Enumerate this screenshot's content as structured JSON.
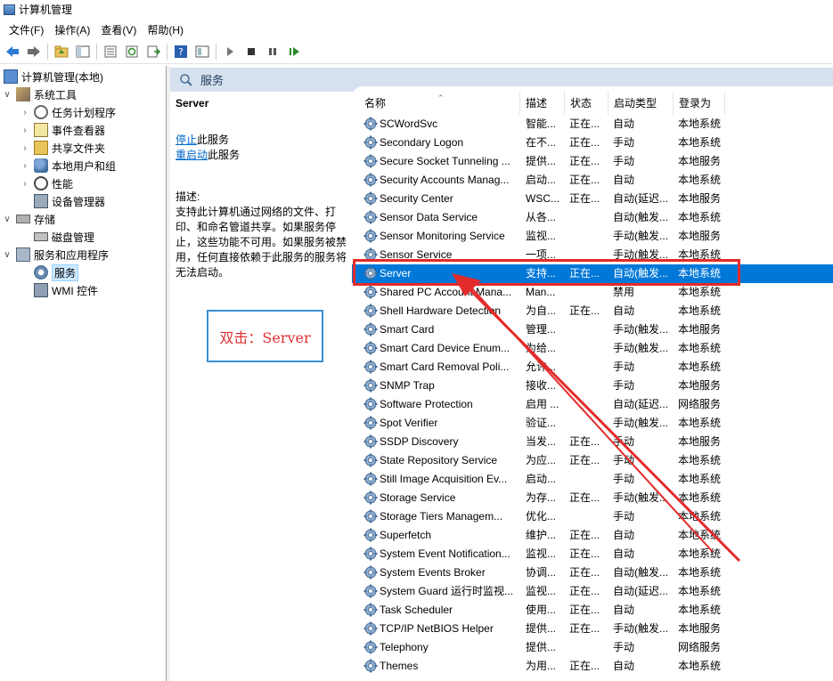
{
  "window": {
    "title": "计算机管理"
  },
  "menu": [
    "文件(F)",
    "操作(A)",
    "查看(V)",
    "帮助(H)"
  ],
  "toolbar": {
    "icons": [
      "back-arrow-icon",
      "forward-arrow-icon",
      "folder-up-icon",
      "show-hide-tree-icon",
      "properties-icon",
      "refresh-icon",
      "export-icon",
      "help-icon",
      "console-icon",
      "play-icon",
      "stop-icon",
      "pause-icon",
      "restart-icon"
    ]
  },
  "tree": {
    "root": "计算机管理(本地)",
    "system_tools": "系统工具",
    "task_scheduler": "任务计划程序",
    "event_viewer": "事件查看器",
    "shared_folders": "共享文件夹",
    "local_users": "本地用户和组",
    "performance": "性能",
    "device_manager": "设备管理器",
    "storage": "存储",
    "disk_management": "磁盘管理",
    "services_apps": "服务和应用程序",
    "services": "服务",
    "wmi": "WMI 控件"
  },
  "panel": {
    "title": "服务"
  },
  "description": {
    "service_name": "Server",
    "stop_link": "停止",
    "stop_suffix": "此服务",
    "restart_link": "重启动",
    "restart_suffix": "此服务",
    "desc_label": "描述:",
    "desc_text": "支持此计算机通过网络的文件、打印、和命名管道共享。如果服务停止，这些功能不可用。如果服务被禁用，任何直接依赖于此服务的服务将无法启动。"
  },
  "columns": {
    "name": "名称",
    "desc": "描述",
    "state": "状态",
    "startup": "启动类型",
    "logon": "登录为"
  },
  "services": [
    {
      "name": "SCWordSvc",
      "desc": "智能...",
      "state": "正在...",
      "startup": "自动",
      "logon": "本地系统"
    },
    {
      "name": "Secondary Logon",
      "desc": "在不...",
      "state": "正在...",
      "startup": "手动",
      "logon": "本地系统"
    },
    {
      "name": "Secure Socket Tunneling ...",
      "desc": "提供...",
      "state": "正在...",
      "startup": "手动",
      "logon": "本地服务"
    },
    {
      "name": "Security Accounts Manag...",
      "desc": "启动...",
      "state": "正在...",
      "startup": "自动",
      "logon": "本地系统"
    },
    {
      "name": "Security Center",
      "desc": "WSC...",
      "state": "正在...",
      "startup": "自动(延迟...",
      "logon": "本地服务"
    },
    {
      "name": "Sensor Data Service",
      "desc": "从各...",
      "state": "",
      "startup": "自动(触发...",
      "logon": "本地系统"
    },
    {
      "name": "Sensor Monitoring Service",
      "desc": "监视...",
      "state": "",
      "startup": "手动(触发...",
      "logon": "本地服务"
    },
    {
      "name": "Sensor Service",
      "desc": "一项...",
      "state": "",
      "startup": "手动(触发...",
      "logon": "本地系统"
    },
    {
      "name": "Server",
      "desc": "支持...",
      "state": "正在...",
      "startup": "自动(触发...",
      "logon": "本地系统"
    },
    {
      "name": "Shared PC Account Mana...",
      "desc": "Man...",
      "state": "",
      "startup": "禁用",
      "logon": "本地系统"
    },
    {
      "name": "Shell Hardware Detection",
      "desc": "为自...",
      "state": "正在...",
      "startup": "自动",
      "logon": "本地系统"
    },
    {
      "name": "Smart Card",
      "desc": "管理...",
      "state": "",
      "startup": "手动(触发...",
      "logon": "本地服务"
    },
    {
      "name": "Smart Card Device Enum...",
      "desc": "为给...",
      "state": "",
      "startup": "手动(触发...",
      "logon": "本地系统"
    },
    {
      "name": "Smart Card Removal Poli...",
      "desc": "允许...",
      "state": "",
      "startup": "手动",
      "logon": "本地系统"
    },
    {
      "name": "SNMP Trap",
      "desc": "接收...",
      "state": "",
      "startup": "手动",
      "logon": "本地服务"
    },
    {
      "name": "Software Protection",
      "desc": "启用 ...",
      "state": "",
      "startup": "自动(延迟...",
      "logon": "网络服务"
    },
    {
      "name": "Spot Verifier",
      "desc": "验证...",
      "state": "",
      "startup": "手动(触发...",
      "logon": "本地系统"
    },
    {
      "name": "SSDP Discovery",
      "desc": "当发...",
      "state": "正在...",
      "startup": "手动",
      "logon": "本地服务"
    },
    {
      "name": "State Repository Service",
      "desc": "为应...",
      "state": "正在...",
      "startup": "手动",
      "logon": "本地系统"
    },
    {
      "name": "Still Image Acquisition Ev...",
      "desc": "启动...",
      "state": "",
      "startup": "手动",
      "logon": "本地系统"
    },
    {
      "name": "Storage Service",
      "desc": "为存...",
      "state": "正在...",
      "startup": "手动(触发...",
      "logon": "本地系统"
    },
    {
      "name": "Storage Tiers Managem...",
      "desc": "优化...",
      "state": "",
      "startup": "手动",
      "logon": "本地系统"
    },
    {
      "name": "Superfetch",
      "desc": "维护...",
      "state": "正在...",
      "startup": "自动",
      "logon": "本地系统"
    },
    {
      "name": "System Event Notification...",
      "desc": "监视...",
      "state": "正在...",
      "startup": "自动",
      "logon": "本地系统"
    },
    {
      "name": "System Events Broker",
      "desc": "协调...",
      "state": "正在...",
      "startup": "自动(触发...",
      "logon": "本地系统"
    },
    {
      "name": "System Guard 运行时监视...",
      "desc": "监视...",
      "state": "正在...",
      "startup": "自动(延迟...",
      "logon": "本地系统"
    },
    {
      "name": "Task Scheduler",
      "desc": "使用...",
      "state": "正在...",
      "startup": "自动",
      "logon": "本地系统"
    },
    {
      "name": "TCP/IP NetBIOS Helper",
      "desc": "提供...",
      "state": "正在...",
      "startup": "手动(触发...",
      "logon": "本地服务"
    },
    {
      "name": "Telephony",
      "desc": "提供...",
      "state": "",
      "startup": "手动",
      "logon": "网络服务"
    },
    {
      "name": "Themes",
      "desc": "为用...",
      "state": "正在...",
      "startup": "自动",
      "logon": "本地系统"
    }
  ],
  "selected_service": "Server",
  "annotation": {
    "text": "双击：Server",
    "box_color": "#3a8fd3",
    "text_color": "#e03030",
    "highlight_color": "#e32b2b"
  }
}
